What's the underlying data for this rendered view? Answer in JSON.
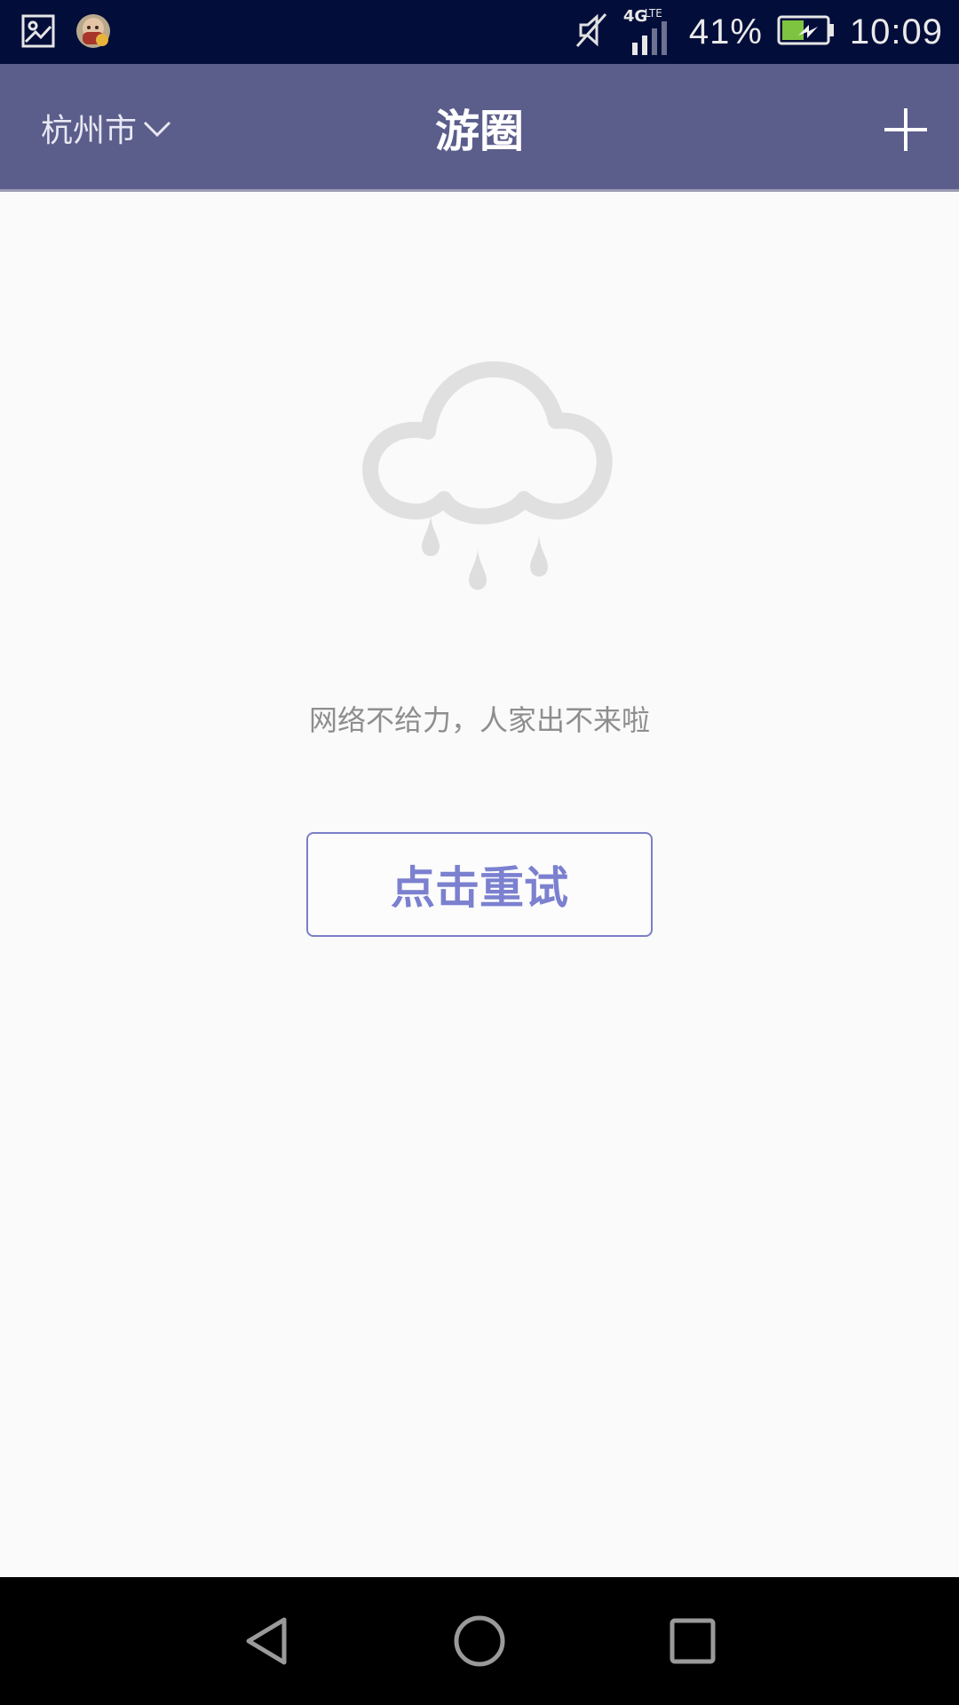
{
  "status_bar": {
    "network": "4G",
    "network_sub": "LTE",
    "battery_percent": "41%",
    "time": "10:09",
    "icons": [
      "gallery-icon",
      "game-avatar-icon",
      "mute-icon",
      "signal-icon",
      "battery-icon"
    ]
  },
  "app_bar": {
    "city": "杭州市",
    "title": "游圈",
    "background": "#5b5d8b"
  },
  "content": {
    "error_message": "网络不给力，人家出不来啦",
    "retry_label": "点击重试",
    "accent_color": "#7b80cf",
    "illustration": "rain-cloud-icon"
  },
  "nav_bar": {
    "buttons": [
      "back-icon",
      "home-icon",
      "recents-icon"
    ]
  }
}
